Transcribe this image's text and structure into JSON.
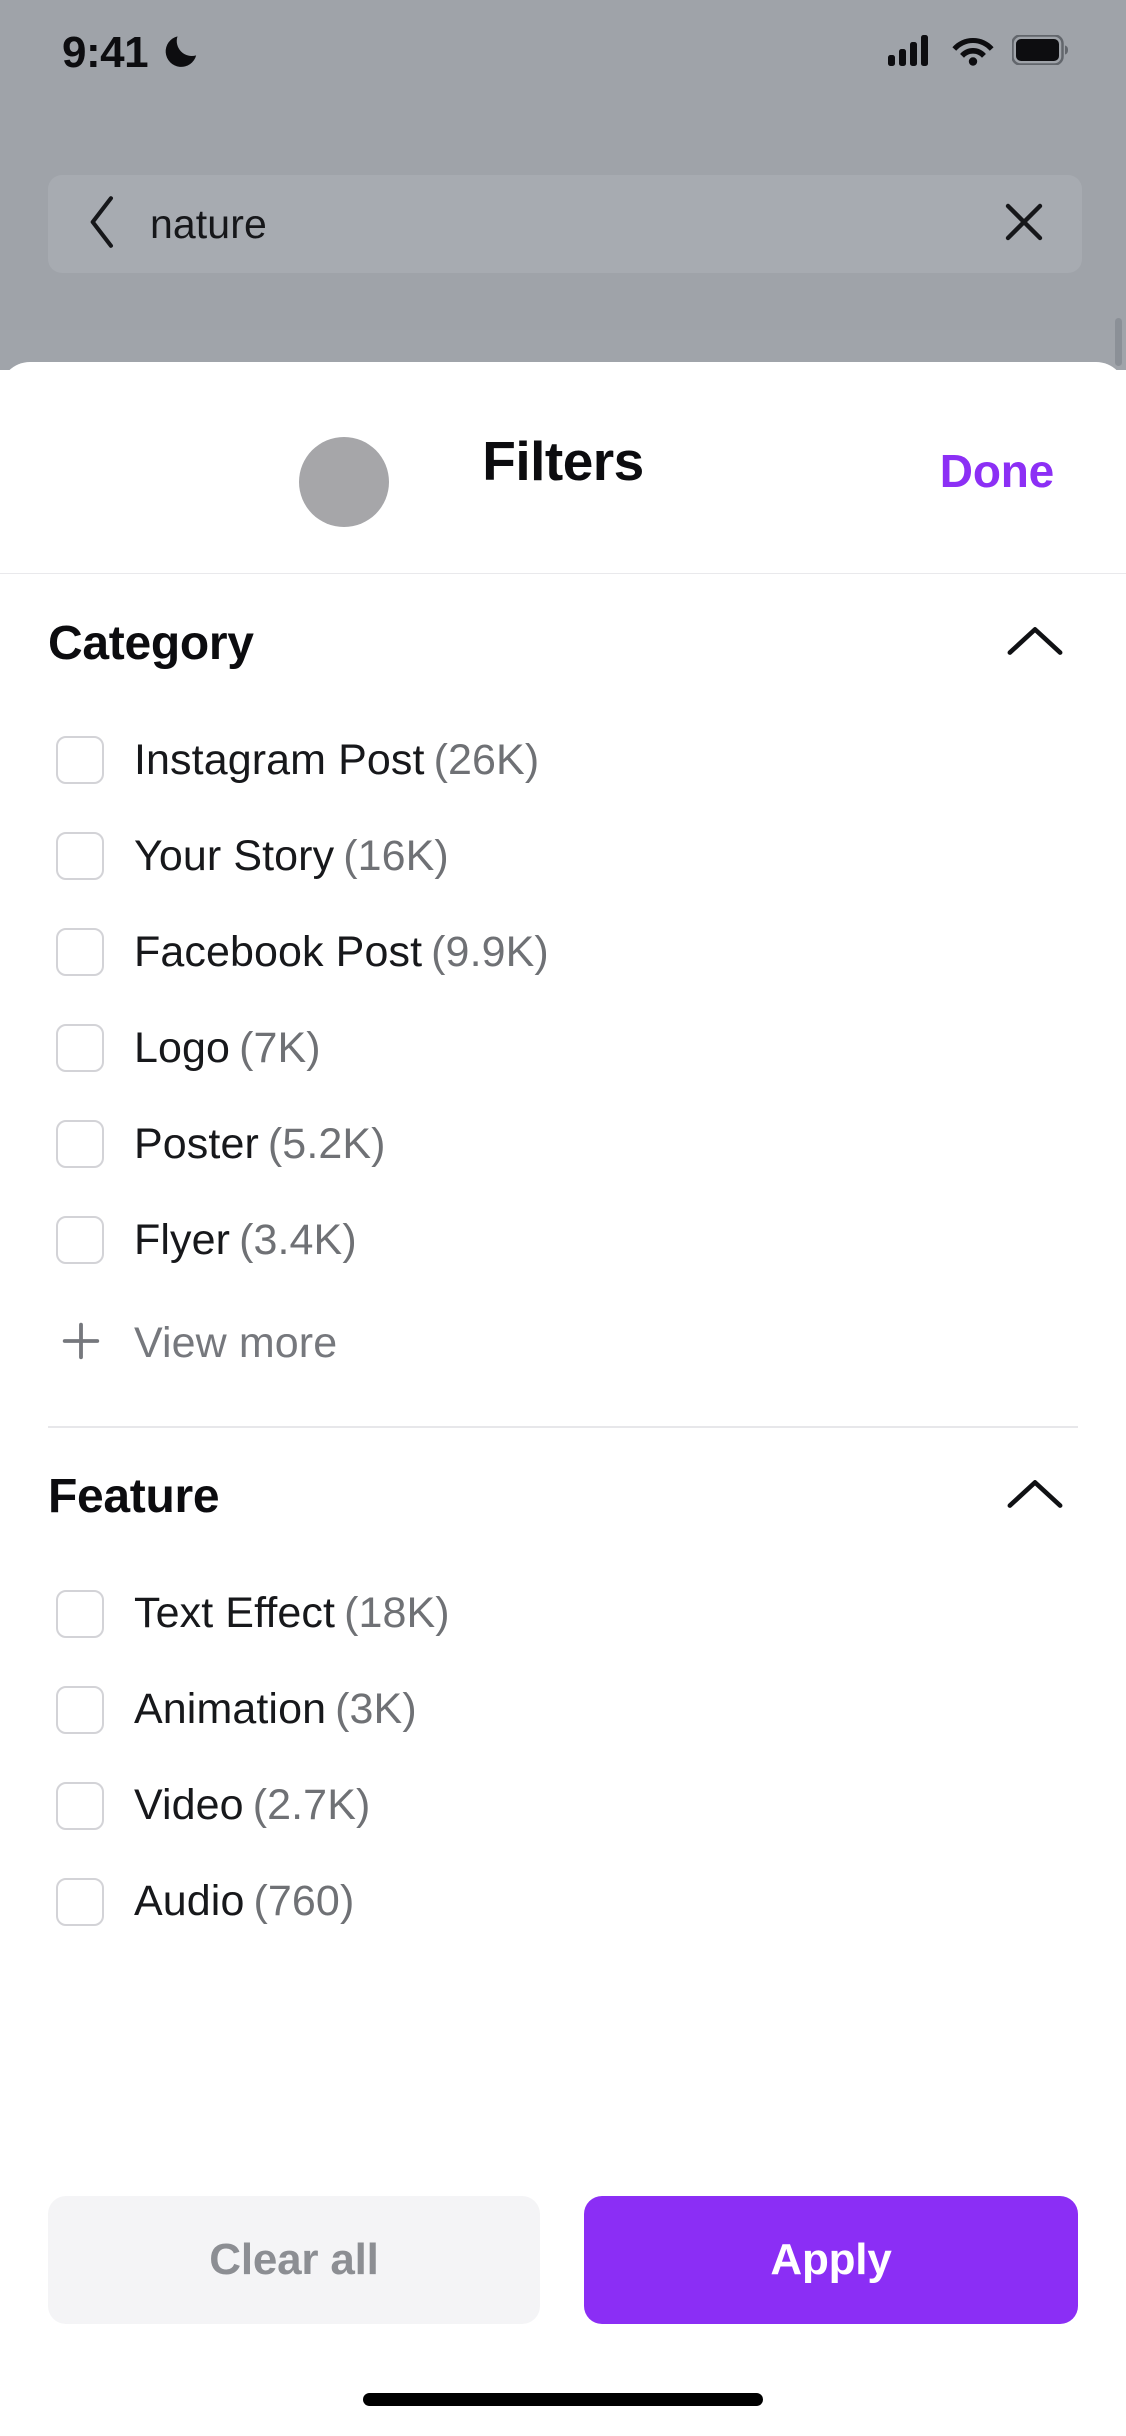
{
  "status_bar": {
    "time": "9:41",
    "dnd_icon": "moon-icon",
    "cellular_icon": "cellular-signal-icon",
    "wifi_icon": "wifi-icon",
    "battery_icon": "battery-icon"
  },
  "search": {
    "back_icon": "chevron-left-icon",
    "query": "nature",
    "clear_icon": "close-x-icon"
  },
  "modal": {
    "title": "Filters",
    "done_label": "Done",
    "avatar": "avatar-placeholder"
  },
  "sections": [
    {
      "title": "Category",
      "collapse_icon": "chevron-up-icon",
      "options": [
        {
          "label": "Instagram Post",
          "count": "(26K)",
          "checked": false
        },
        {
          "label": "Your Story",
          "count": "(16K)",
          "checked": false
        },
        {
          "label": "Facebook Post",
          "count": "(9.9K)",
          "checked": false
        },
        {
          "label": "Logo",
          "count": "(7K)",
          "checked": false
        },
        {
          "label": "Poster",
          "count": "(5.2K)",
          "checked": false
        },
        {
          "label": "Flyer",
          "count": "(3.4K)",
          "checked": false
        }
      ],
      "view_more_label": "View more",
      "view_more_icon": "plus-icon"
    },
    {
      "title": "Feature",
      "collapse_icon": "chevron-up-icon",
      "options": [
        {
          "label": "Text Effect",
          "count": "(18K)",
          "checked": false
        },
        {
          "label": "Animation",
          "count": "(3K)",
          "checked": false
        },
        {
          "label": "Video",
          "count": "(2.7K)",
          "checked": false
        },
        {
          "label": "Audio",
          "count": "(760)",
          "checked": false
        }
      ]
    }
  ],
  "footer": {
    "clear_label": "Clear all",
    "apply_label": "Apply"
  },
  "colors": {
    "accent_purple": "#8B2EF5",
    "done_purple": "#8C2FF5",
    "clear_bg": "#F4F4F6",
    "clear_text": "#8C8E93",
    "count_gray": "#6F7175",
    "backdrop_gray": "#9FA3A9"
  }
}
